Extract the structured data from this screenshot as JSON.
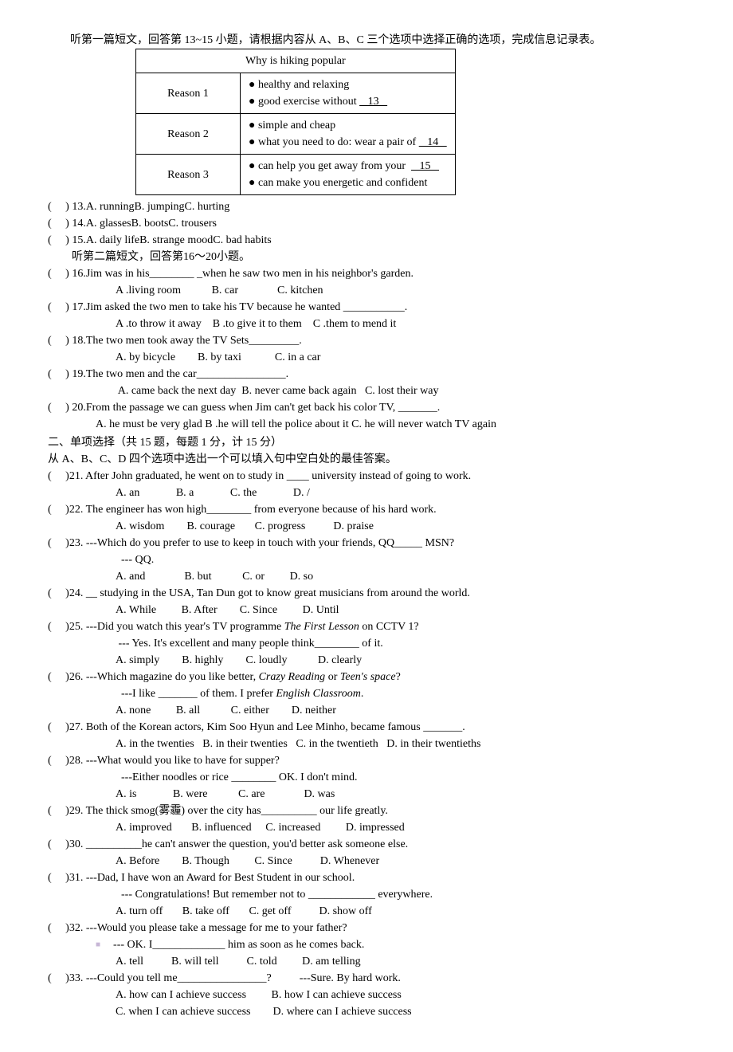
{
  "intro1": "听第一篇短文，回答第 13~15 小题，请根据内容从 A、B、C 三个选项中选择正确的选项，完成信息记录表。",
  "table": {
    "title": "Why is hiking popular",
    "rows": [
      {
        "label": "Reason 1",
        "lines": [
          "● healthy and relaxing",
          "● good exercise without    13   "
        ]
      },
      {
        "label": "Reason 2",
        "lines": [
          "● simple and cheap",
          "● what you need to do: wear a pair of    14   "
        ]
      },
      {
        "label": "Reason 3",
        "lines": [
          "● can help you get away from your    15   ",
          "● can make you energetic and confident"
        ]
      }
    ]
  },
  "q13": {
    "num": "13.",
    "a": "A. running",
    "b": "B. jumping",
    "c": "C. hurting"
  },
  "q14": {
    "num": "14.",
    "a": "A. glasses",
    "b": "B. boots",
    "c": "C. trousers"
  },
  "q15": {
    "num": "15.",
    "a": "A. daily life",
    "b": "B. strange mood",
    "c": "C. bad habits"
  },
  "intro2": "听第二篇短文，回答第16～20小题。",
  "q16": {
    "stem": "16.Jim was in his________ _when he saw two men in his neighbor's garden.",
    "a": "A .living room",
    "b": "B. car",
    "c": "C. kitchen"
  },
  "q17": {
    "stem": "17.Jim asked the two men to take his TV because he wanted ___________.",
    "a": "A .to throw it away",
    "b": "B .to give it to them",
    "c": "C .them to mend it"
  },
  "q18": {
    "stem": "18.The two men took away the TV Sets_________.",
    "a": "A. by bicycle",
    "b": "B. by taxi",
    "c": "C. in a car"
  },
  "q19": {
    "stem": "19.The two men and the car________________.",
    "a": "A. came back the next day",
    "b": "B. never came back again",
    "c": "C. lost their way"
  },
  "q20": {
    "stem": "20.From the passage we can guess when Jim can't get back his color TV, _______.",
    "a": "A. he must be very glad",
    "b": "B .he will tell the police about it",
    "c": "C. he will never watch TV again"
  },
  "section2_title": "二、单项选择（共 15 题，每题 1 分，计 15 分）",
  "section2_inst": "从 A、B、C、D 四个选项中选出一个可以填入句中空白处的最佳答案。",
  "q21": {
    "stem": "21. After John graduated, he went on to study in ____ university instead of going to work.",
    "a": "A. an",
    "b": "B. a",
    "c": "C. the",
    "d": "D. /"
  },
  "q22": {
    "stem": "22. The engineer has won high________ from everyone because of his hard work.",
    "a": "A. wisdom",
    "b": "B. courage",
    "c": "C. progress",
    "d": "D. praise"
  },
  "q23": {
    "stem1": "23. ---Which do you prefer to use to keep in touch with your friends, QQ_____ MSN?",
    "stem2": "--- QQ.",
    "a": "A. and",
    "b": "B. but",
    "c": "C. or",
    "d": "D. so"
  },
  "q24": {
    "stem": "24. __ studying in the USA, Tan Dun got to know great musicians from around the world.",
    "a": "A. While",
    "b": "B. After",
    "c": "C. Since",
    "d": "D. Until"
  },
  "q25": {
    "stem1a": "25. ---Did you watch this year's TV programme ",
    "stem1b": "The First Lesson",
    "stem1c": " on CCTV 1?",
    "stem2": "--- Yes. It's excellent and many people think________ of it.",
    "a": "A. simply",
    "b": "B. highly",
    "c": "C. loudly",
    "d": "D. clearly"
  },
  "q26": {
    "stem1a": "26. ---Which magazine do you like better, ",
    "stem1b": "Crazy Reading",
    "stem1c": " or ",
    "stem1d": "Teen's space",
    "stem1e": "?",
    "stem2a": "---I like _______ of them. I prefer ",
    "stem2b": "English Classroom",
    "stem2c": ".",
    "a": "A. none",
    "b": "B. all",
    "c": "C. either",
    "d": "D. neither"
  },
  "q27": {
    "stem": "27. Both of the Korean actors, Kim Soo Hyun and Lee Minho, became famous _______.",
    "a": "A. in the twenties",
    "b": "B. in their twenties",
    "c": "C. in the twentieth",
    "d": "D. in their twentieths"
  },
  "q28": {
    "stem1": "28. ---What would you like to have for supper?",
    "stem2": "---Either noodles or rice ________ OK. I don't mind.",
    "a": "A. is",
    "b": "B. were",
    "c": "C. are",
    "d": "D. was"
  },
  "q29": {
    "stem": "29. The thick smog(雾霾) over the city has__________ our life greatly.",
    "a": "A. improved",
    "b": "B. influenced",
    "c": "C. increased",
    "d": "D. impressed"
  },
  "q30": {
    "stem": "30. __________he can't answer the question, you'd better ask someone else.",
    "a": "A. Before",
    "b": "B. Though",
    "c": "C. Since",
    "d": "D. Whenever"
  },
  "q31": {
    "stem1": "31. ---Dad, I have won an Award for Best Student in our school.",
    "stem2": "--- Congratulations! But remember not to ____________ everywhere.",
    "a": "A. turn off",
    "b": "B. take off",
    "c": "C. get off",
    "d": "D. show off"
  },
  "q32": {
    "stem1": "32. ---Would you please take a message for me to your father?",
    "stem2": "--- OK. I_____________ him as soon as he comes back.",
    "a": "A. tell",
    "b": "B. will tell",
    "c": "C. told",
    "d": "D. am telling"
  },
  "q33": {
    "stem": "33. ---Could you tell me________________?          ---Sure. By hard work.",
    "a": "A. how can I achieve success",
    "b": "B. how I can achieve success",
    "c": "C. when I can achieve success",
    "d": "D. where can I achieve success"
  }
}
